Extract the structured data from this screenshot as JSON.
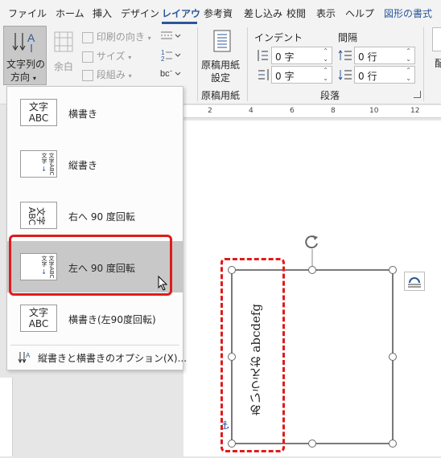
{
  "tabs": [
    "ファイル",
    "ホーム",
    "挿入",
    "デザイン",
    "レイアウ",
    "参考資",
    "差し込み",
    "校閲",
    "表示",
    "ヘルプ",
    "図形の書式"
  ],
  "ribbon": {
    "text_direction_label_1": "文字列の",
    "text_direction_label_2": "方向",
    "margins_label": "余白",
    "print_direction": "印刷の向き",
    "size": "サイズ",
    "columns": "段組み",
    "manuscript_label_1": "原稿用紙",
    "manuscript_label_2": "設定",
    "manuscript_group": "原稿用紙",
    "indent_header": "インデント",
    "spacing_header": "間隔",
    "indent_left": "0 字",
    "indent_right": "0 字",
    "space_before": "0 行",
    "space_after": "0 行",
    "paragraph_group": "段落",
    "right_edge_char": "配"
  },
  "dropdown": {
    "items": [
      {
        "label": "横書き",
        "thumb": "文字\nABC"
      },
      {
        "label": "縦書き",
        "thumb": "文字ABC"
      },
      {
        "label": "右へ 90 度回転",
        "thumb": "文字ABC"
      },
      {
        "label": "左へ 90 度回転",
        "thumb": "文字ABC"
      },
      {
        "label": "横書き(左90度回転)",
        "thumb": "文字\nABC"
      }
    ],
    "options_label": "縦書きと横書きのオプション(X)..."
  },
  "ruler": {
    "ticks": [
      "2",
      "4",
      "6",
      "8",
      "10",
      "12"
    ]
  },
  "textbox": {
    "content": "あいうえお abcdefg"
  },
  "colors": {
    "accent": "#2b579a",
    "highlight": "#e01b1b"
  }
}
